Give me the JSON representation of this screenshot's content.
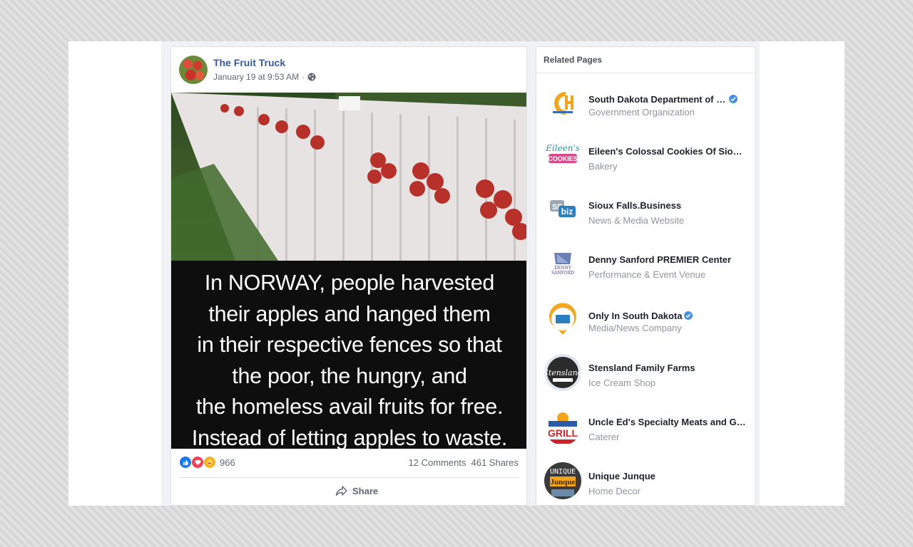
{
  "post": {
    "page_name": "The Fruit Truck",
    "timestamp": "January 19 at 9:53 AM",
    "separator": "·",
    "privacy_icon": "globe-icon",
    "caption_lines": [
      "In NORWAY, people harvested",
      "their apples and hanged them",
      "in their respective fences so that",
      "the poor, the hungry, and",
      "the homeless avail fruits for free.",
      "Instead of letting apples to waste."
    ],
    "reaction_icons": [
      "like-icon",
      "love-icon",
      "care-icon"
    ],
    "reaction_count": "966",
    "comments": "12 Comments",
    "shares": "461 Shares",
    "share_label": "Share",
    "colors": {
      "link": "#385898",
      "meta": "#606770"
    }
  },
  "related": {
    "title": "Related Pages",
    "items": [
      {
        "name": "South Dakota Department of Health",
        "category": "Government Organization",
        "verified": true,
        "logo_icon": "health-logo-icon"
      },
      {
        "name": "Eileen's Colossal Cookies Of Sioux Falls",
        "category": "Bakery",
        "verified": false,
        "logo_icon": "cookies-logo-icon"
      },
      {
        "name": "Sioux Falls.Business",
        "category": "News & Media Website",
        "verified": false,
        "logo_icon": "sfbiz-logo-icon"
      },
      {
        "name": "Denny Sanford PREMIER Center",
        "category": "Performance & Event Venue",
        "verified": false,
        "logo_icon": "premier-center-logo-icon"
      },
      {
        "name": "Only In South Dakota",
        "category": "Media/News Company",
        "verified": true,
        "logo_icon": "map-pin-logo-icon"
      },
      {
        "name": "Stensland Family Farms",
        "category": "Ice Cream Shop",
        "verified": false,
        "logo_icon": "stensland-logo-icon"
      },
      {
        "name": "Uncle Ed's Specialty Meats and Grill Master",
        "category": "Caterer",
        "verified": false,
        "logo_icon": "grill-master-logo-icon"
      },
      {
        "name": "Unique Junque",
        "category": "Home Decor",
        "verified": false,
        "logo_icon": "unique-junque-logo-icon"
      }
    ],
    "colors": {
      "verified": "#4a90e2",
      "category": "#90949c"
    }
  }
}
